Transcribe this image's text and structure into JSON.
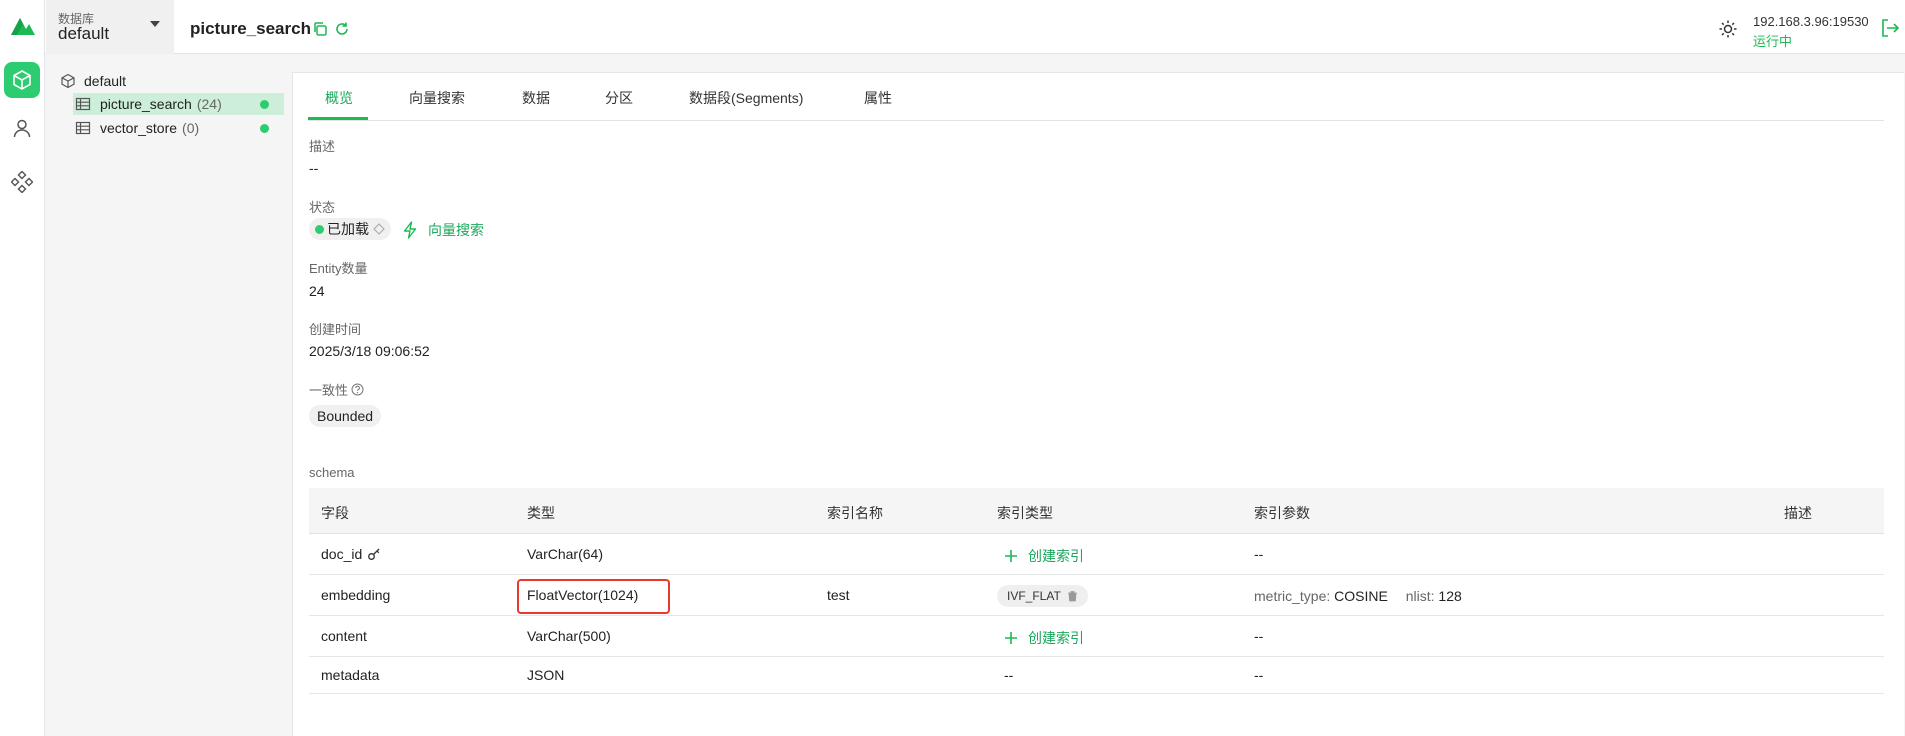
{
  "header": {
    "db_label": "数据库",
    "db_value": "default",
    "collection_title": "picture_search",
    "connection_address": "192.168.3.96:19530",
    "connection_status": "运行中"
  },
  "sidebar": {
    "nav": [
      "database-icon",
      "user-icon",
      "system-icon"
    ],
    "tree": {
      "root": "default",
      "collections": [
        {
          "name": "picture_search",
          "count": "(24)"
        },
        {
          "name": "vector_store",
          "count": "(0)"
        }
      ]
    }
  },
  "tabs": [
    "概览",
    "向量搜索",
    "数据",
    "分区",
    "数据段(Segments)",
    "属性"
  ],
  "overview": {
    "desc_label": "描述",
    "desc_value": "--",
    "status_label": "状态",
    "status_value": "已加载",
    "vector_search_link": "向量搜索",
    "entity_label": "Entity数量",
    "entity_value": "24",
    "created_label": "创建时间",
    "created_value": "2025/3/18 09:06:52",
    "consistency_label": "一致性",
    "consistency_value": "Bounded",
    "schema_label": "schema"
  },
  "schema": {
    "headers": [
      "字段",
      "类型",
      "索引名称",
      "索引类型",
      "索引参数",
      "描述"
    ],
    "rows": [
      {
        "field": "doc_id",
        "type": "VarChar(64)",
        "index_name": "",
        "index_type": "创建索引",
        "params": "--"
      },
      {
        "field": "embedding",
        "type": "FloatVector(1024)",
        "index_name": "test",
        "index_type": "IVF_FLAT",
        "params_k1": "metric_type:",
        "params_v1": "COSINE",
        "params_k2": "nlist:",
        "params_v2": "128"
      },
      {
        "field": "content",
        "type": "VarChar(500)",
        "index_name": "",
        "index_type": "创建索引",
        "params": "--"
      },
      {
        "field": "metadata",
        "type": "JSON",
        "index_name": "",
        "index_type": "--",
        "params": "--"
      }
    ]
  },
  "colors": {
    "accent": "#1db954",
    "highlight": "#e53b2c"
  }
}
